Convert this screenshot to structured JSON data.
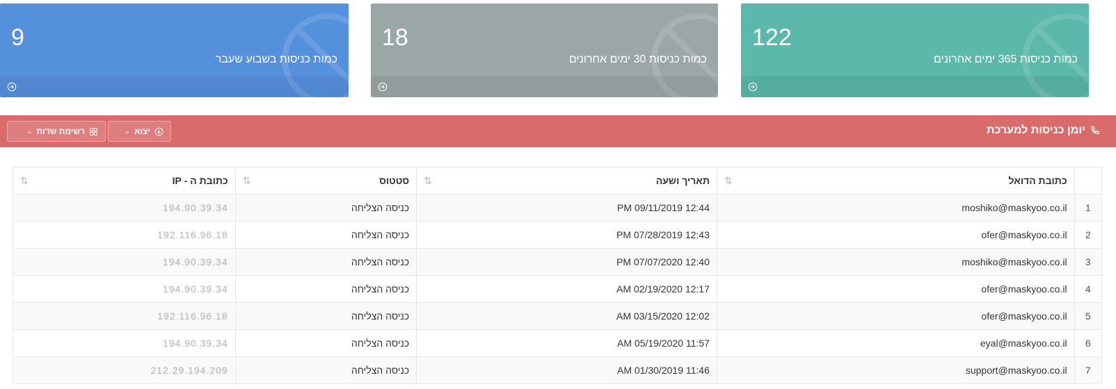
{
  "colors": {
    "blue": "#5590dd",
    "gray": "#9ba7a7",
    "teal": "#5bb8ab",
    "red": "#da6b6b"
  },
  "stats": [
    {
      "value": "9",
      "label": "כמות כניסות בשבוע שעבר",
      "color": "#5590dd",
      "icon": "block-icon"
    },
    {
      "value": "18",
      "label": "כמות כניסות 30 ימים אחרונים",
      "color": "#9ba7a7",
      "icon": "block-icon"
    },
    {
      "value": "122",
      "label": "כמות כניסות 365 ימים אחרונים",
      "color": "#5bb8ab",
      "icon": "block-icon"
    }
  ],
  "panel": {
    "title": "יומן כניסות למערכת",
    "export_label": "יצוא",
    "fields_label": "רשימת שדות"
  },
  "table": {
    "columns": [
      "",
      "כתובת הדואל",
      "תאריך ושעה",
      "סטטוס",
      "כתובת ה - IP"
    ],
    "rows": [
      {
        "n": "1",
        "email": "moshiko@maskyoo.co.il",
        "date": "PM 09/11/2019 12:44",
        "status": "כניסה הצליחה",
        "ip": "194.90.39.34"
      },
      {
        "n": "2",
        "email": "ofer@maskyoo.co.il",
        "date": "PM 07/28/2019 12:43",
        "status": "כניסה הצליחה",
        "ip": "192.116.96.18"
      },
      {
        "n": "3",
        "email": "moshiko@maskyoo.co.il",
        "date": "PM 07/07/2020 12:40",
        "status": "כניסה הצליחה",
        "ip": "194.90.39.34"
      },
      {
        "n": "4",
        "email": "ofer@maskyoo.co.il",
        "date": "AM 02/19/2020 12:17",
        "status": "כניסה הצליחה",
        "ip": "194.90.39.34"
      },
      {
        "n": "5",
        "email": "ofer@maskyoo.co.il",
        "date": "AM 03/15/2020 12:02",
        "status": "כניסה הצליחה",
        "ip": "192.116.96.18"
      },
      {
        "n": "6",
        "email": "eyal@maskyoo.co.il",
        "date": "AM 05/19/2020 11:57",
        "status": "כניסה הצליחה",
        "ip": "194.90.39.34"
      },
      {
        "n": "7",
        "email": "support@maskyoo.co.il",
        "date": "AM 01/30/2019 11:46",
        "status": "כניסה הצליחה",
        "ip": "212.29.194.209"
      }
    ]
  }
}
